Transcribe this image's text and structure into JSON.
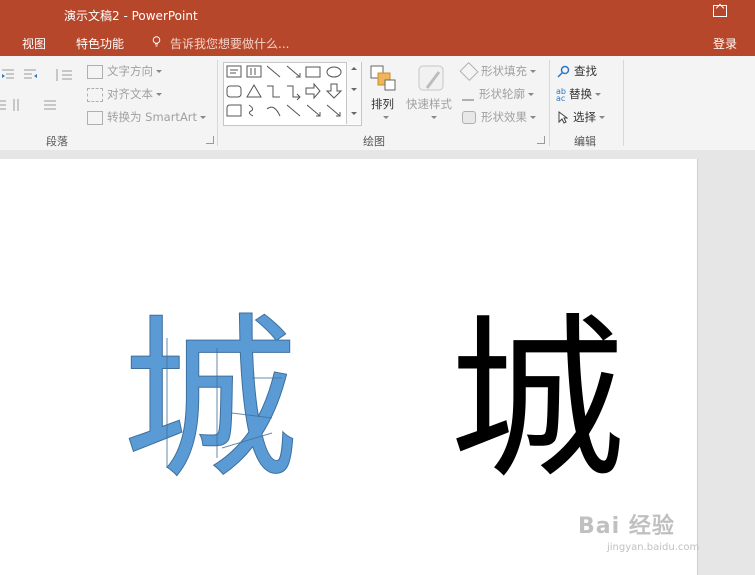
{
  "window": {
    "title": "演示文稿2 - PowerPoint"
  },
  "menu": {
    "items": [
      "视图",
      "特色功能"
    ],
    "tell_me": "告诉我您想要做什么...",
    "sign_in": "登录"
  },
  "ribbon": {
    "paragraph": {
      "label": "段落",
      "text_direction": "文字方向",
      "align_text": "对齐文本",
      "convert_smartart": "转换为 SmartArt"
    },
    "drawing": {
      "label": "绘图",
      "arrange": "排列",
      "quick_styles": "快速样式",
      "shape_fill": "形状填充",
      "shape_outline": "形状轮廓",
      "shape_effects": "形状效果"
    },
    "editing": {
      "label": "编辑",
      "find": "查找",
      "replace": "替换",
      "select": "选择"
    }
  },
  "slide": {
    "char_left": "城",
    "char_right": "城"
  },
  "watermark": {
    "brand": "Bai 经验",
    "url": "jingyan.baidu.com"
  },
  "colors": {
    "accent": "#b7472a",
    "shape_fill": "#5b9bd5",
    "shape_outline": "#3e6f9c"
  }
}
